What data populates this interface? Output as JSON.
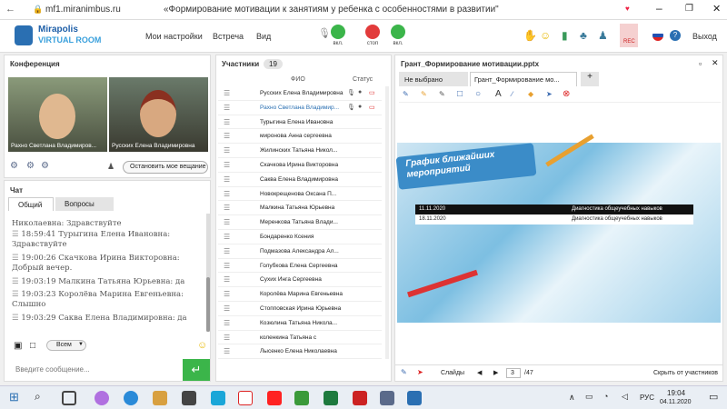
{
  "browser": {
    "url": "mf1.miranimbus.ru",
    "title": "«Формирование мотивации к занятиям у ребенка с особенностями в развитии\""
  },
  "app": {
    "logo_top": "Mirapolis",
    "logo_bottom": "VIRTUAL ROOM",
    "menu": [
      "Мои настройки",
      "Встреча",
      "Вид"
    ],
    "mic": "вкл.",
    "cam": "стоп",
    "screen": "вкл.",
    "rec": "REC",
    "exit": "Выход"
  },
  "conference": {
    "title": "Конференция",
    "video1": "Рахно Светлана Владимиров...",
    "video2": "Русских Елена Владимировна",
    "stop_button": "Остановить мое вещание"
  },
  "chat": {
    "title": "Чат",
    "tabs": [
      "Общий",
      "Вопросы"
    ],
    "messages": [
      {
        "time": "",
        "name": "Николаевна:",
        "text": "Здравствуйте"
      },
      {
        "time": "18:59:41",
        "name": "Турыгина Елена Ивановна:",
        "text": "Здравствуйте"
      },
      {
        "time": "19:00:26",
        "name": "Скачкова Ирина Викторовна:",
        "text": "Добрый вечер."
      },
      {
        "time": "19:03:19",
        "name": "Малкина Татьяна Юрьевна:",
        "text": "да"
      },
      {
        "time": "19:03:23",
        "name": "Королёва Марина Евгеньевна:",
        "text": "Слышно"
      },
      {
        "time": "19:03:29",
        "name": "Саква Елена Владимировна:",
        "text": "да"
      }
    ],
    "recipient": "Всем",
    "placeholder": "Введите сообщение..."
  },
  "participants": {
    "title": "Участники",
    "count": "19",
    "col_fio": "ФИО",
    "col_status": "Статус",
    "list": [
      "Русских Елена Владимировна",
      "Рахно Светлана Владимир...",
      "Турыгина Елена Ивановна",
      "миронова Анна сергеевна",
      "Жилинских Татьяна Никол...",
      "Скачкова Ирина Викторовна",
      "Саква Елена Владимировна",
      "Новокрещенова Оксана П...",
      "Малкина Татьяна Юрьевна",
      "Меренкова Татьяна Влади...",
      "Бондаренко Ксения",
      "Подмазова Александра Ал...",
      "Голубкова Елена Сергеевна",
      "Сухих Инга Сергеевна",
      "Королёва Марина Евгеньевна",
      "Стопповская Ирина Юрьевна",
      "Козюлина Татьяна Никола...",
      "коленкина Татьяна с",
      "Лысенко Елена Николаевна"
    ]
  },
  "presentation": {
    "title": "Грант_Формирование мотивации.pptx",
    "tabs": [
      "Не выбрано",
      "Грант_Формирование мо...",
      "+"
    ],
    "slide_title": "График ближайших мероприятий",
    "table": [
      [
        "11.11.2020",
        "Диагностика общеучебных навыков"
      ],
      [
        "18.11.2020",
        "Диагностика общеучебных навыков"
      ]
    ],
    "slides_label": "Слайды",
    "page": "3",
    "total": "/47",
    "hide": "Скрыть от участников"
  },
  "taskbar": {
    "lang": "РУС",
    "time": "19:04",
    "date": "04.11.2020"
  }
}
